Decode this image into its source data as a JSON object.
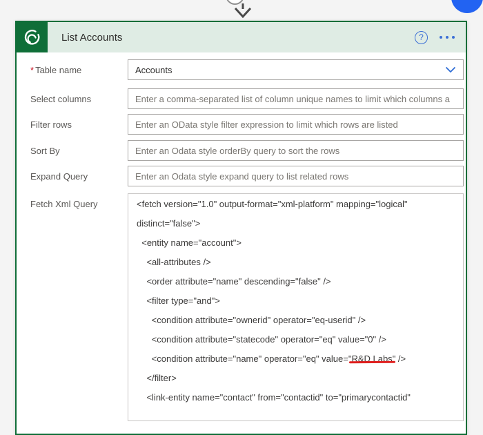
{
  "window": {
    "background": "#f4f4f4"
  },
  "decorations": {
    "insert_arrow_icon": "arrow-down",
    "insert_circle_icon": "insert-step-circle",
    "floating_button": {
      "icon": "blue-circle",
      "color": "#2263f2"
    }
  },
  "card": {
    "title": "List Accounts",
    "brand_green": "#0f6e38",
    "header_bg": "#dfece4",
    "connector_icon": "dataverse-swirl",
    "help_glyph": "?",
    "menu_icon": "ellipsis-horizontal"
  },
  "fields": [
    {
      "label": "Table name",
      "required_marker": "*",
      "type": "dropdown",
      "value": "Accounts"
    },
    {
      "label": "Select columns",
      "type": "text",
      "placeholder": "Enter a comma-separated list of column unique names to limit which columns a"
    },
    {
      "label": "Filter rows",
      "type": "text",
      "placeholder": "Enter an OData style filter expression to limit which rows are listed"
    },
    {
      "label": "Sort By",
      "type": "text",
      "placeholder": "Enter an Odata style orderBy query to sort the rows"
    },
    {
      "label": "Expand Query",
      "type": "text",
      "placeholder": "Enter an Odata style expand query to list related rows"
    },
    {
      "label": "Fetch Xml Query",
      "type": "textarea"
    }
  ],
  "fetch_xml": {
    "underline_color": "#e0201f",
    "lines": [
      {
        "text": "<fetch version=\"1.0\" output-format=\"xml-platform\" mapping=\"logical\""
      },
      {
        "text": "distinct=\"false\">"
      },
      {
        "text": "  <entity name=\"account\">"
      },
      {
        "text": "    <all-attributes />"
      },
      {
        "text": "    <order attribute=\"name\" descending=\"false\" />"
      },
      {
        "text": "    <filter type=\"and\">"
      },
      {
        "text": "      <condition attribute=\"ownerid\" operator=\"eq-userid\" />"
      },
      {
        "text": "      <condition attribute=\"statecode\" operator=\"eq\" value=\"0\" />"
      },
      {
        "text": "      <condition attribute=\"name\" operator=\"eq\" value=\"R&D Labs\" />",
        "highlight": "R&D Labs"
      },
      {
        "text": "    </filter>"
      },
      {
        "text": "    <link-entity name=\"contact\" from=\"contactid\" to=\"primarycontactid\""
      }
    ]
  }
}
